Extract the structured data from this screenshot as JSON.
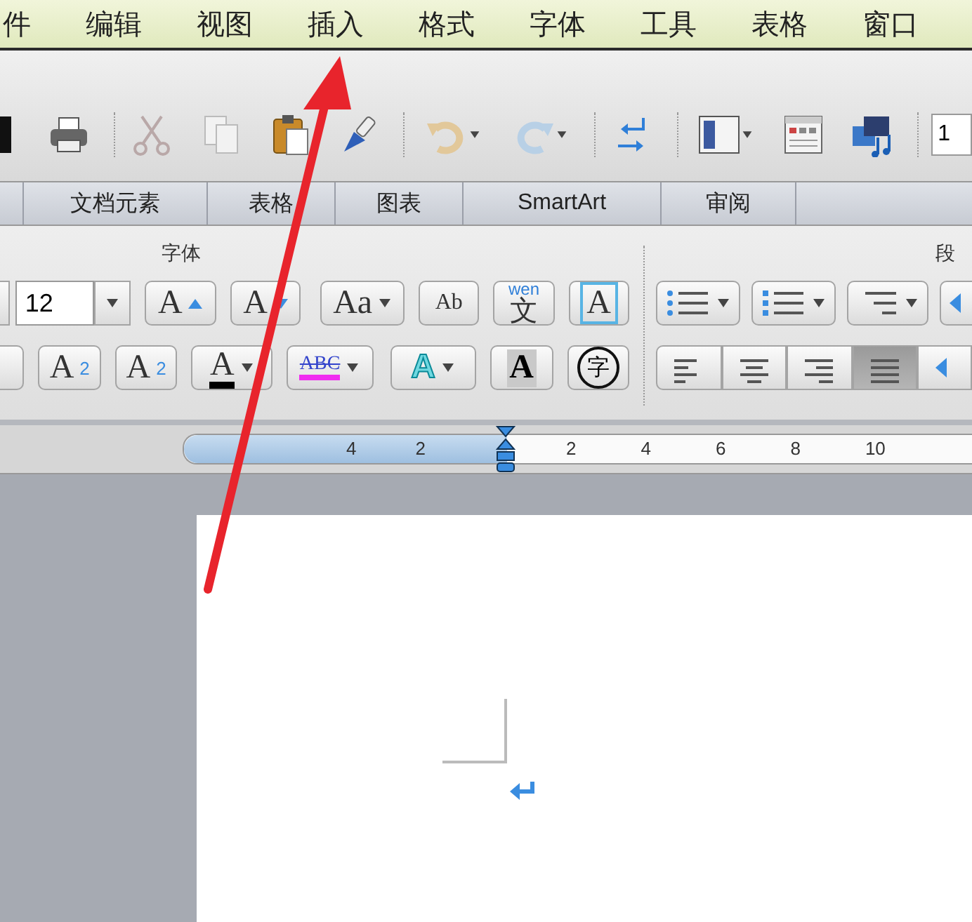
{
  "menu_bar": {
    "items": [
      "件",
      "编辑",
      "视图",
      "插入",
      "格式",
      "字体",
      "工具",
      "表格",
      "窗口"
    ]
  },
  "toolbar": {
    "zoom_field": "1"
  },
  "ribbon_tabs": [
    {
      "label": "文档元素",
      "selected": false
    },
    {
      "label": "表格",
      "selected": false
    },
    {
      "label": "图表",
      "selected": false
    },
    {
      "label": "SmartArt",
      "selected": false
    },
    {
      "label": "审阅",
      "selected": false
    }
  ],
  "font_group": {
    "title": "字体",
    "font_size": "12",
    "row1": [
      {
        "kind": "grow",
        "glyph": "A"
      },
      {
        "kind": "shrink",
        "glyph": "A"
      },
      {
        "kind": "case",
        "glyph": "Aa"
      },
      {
        "kind": "clear",
        "glyph": "Ab"
      },
      {
        "kind": "phonetic",
        "top": "wen",
        "glyph": "文"
      },
      {
        "kind": "border",
        "glyph": "A"
      }
    ],
    "row2": [
      {
        "kind": "super",
        "glyph": "A",
        "mark": "2"
      },
      {
        "kind": "sub",
        "glyph": "A",
        "mark": "2"
      },
      {
        "kind": "color",
        "glyph": "A"
      },
      {
        "kind": "highlight",
        "glyph": "ABC"
      },
      {
        "kind": "effects",
        "glyph": "A"
      },
      {
        "kind": "shading",
        "glyph": "A"
      },
      {
        "kind": "enclose",
        "glyph": "字"
      }
    ]
  },
  "paragraph_group": {
    "title": "段",
    "alignment": [
      {
        "kind": "left",
        "selected": false
      },
      {
        "kind": "center",
        "selected": false
      },
      {
        "kind": "right",
        "selected": false
      },
      {
        "kind": "justify",
        "selected": true
      }
    ]
  },
  "ruler": {
    "left_labels": [
      "4",
      "2"
    ],
    "right_labels": [
      "2",
      "4",
      "6",
      "8",
      "10"
    ]
  }
}
